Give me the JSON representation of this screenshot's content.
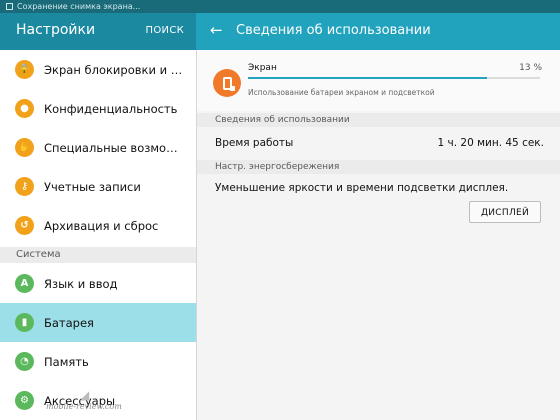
{
  "status_bar": {
    "notification_text": "Сохранение снимка экрана..."
  },
  "left_header": {
    "title": "Настройки",
    "search_label": "ПОИСК"
  },
  "right_header": {
    "title": "Сведения об использовании"
  },
  "sidebar": {
    "items_top": [
      {
        "label": "Экран блокировки и защ…",
        "icon": "lock-icon",
        "color": "#f2a21a"
      },
      {
        "label": "Конфиденциальность",
        "icon": "shield-icon",
        "color": "#f2a21a"
      },
      {
        "label": "Специальные возможно…",
        "icon": "hand-icon",
        "color": "#f2a21a"
      },
      {
        "label": "Учетные записи",
        "icon": "key-icon",
        "color": "#f2a21a"
      },
      {
        "label": "Архивация и сброс",
        "icon": "backup-icon",
        "color": "#f2a21a"
      }
    ],
    "section_label": "Система",
    "items_system": [
      {
        "label": "Язык и ввод",
        "icon": "language-icon",
        "color": "#5cb85c"
      },
      {
        "label": "Батарея",
        "icon": "battery-icon",
        "color": "#5cb85c",
        "active": true
      },
      {
        "label": "Память",
        "icon": "memory-icon",
        "color": "#5cb85c"
      },
      {
        "label": "Аксессуары",
        "icon": "accessories-icon",
        "color": "#5cb85c"
      }
    ]
  },
  "usage_card": {
    "name": "Экран",
    "percent_label": "13 %",
    "percent": 0.82,
    "description": "Использование батареи экраном и подсветкой",
    "icon_color": "#f07a2a"
  },
  "usage_section": {
    "header": "Сведения об использовании",
    "runtime_label": "Время работы",
    "runtime_value": "1 ч. 20 мин. 45 сек."
  },
  "power_section": {
    "header": "Настр. энергосбережения",
    "text": "Уменьшение яркости и времени подсветки дисплея.",
    "button_label": "ДИСПЛЕЙ"
  },
  "watermark": "mobile-review.com"
}
